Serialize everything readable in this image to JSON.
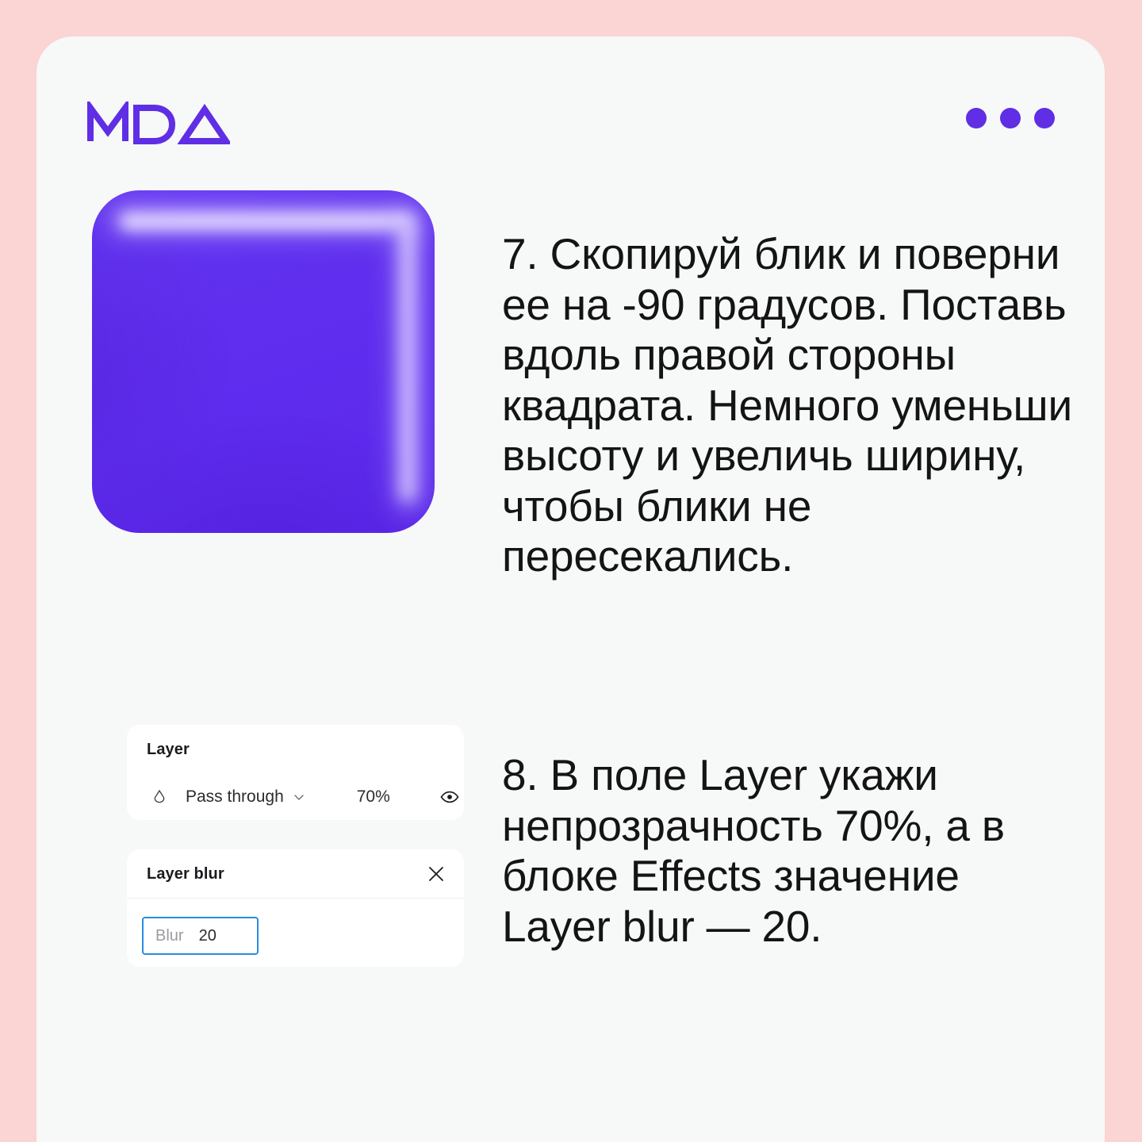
{
  "theme": {
    "page_background": "#FBD4D4",
    "card_background": "#F7F8F8",
    "brand_purple": "#5F2EE5",
    "square_fill": "#5F2EEE",
    "input_focus_blue": "#2B8CE0",
    "text_color": "#141414"
  },
  "header": {
    "logo_text": "MDA",
    "menu_icon": "kebab-menu-icon",
    "dots_count": 3
  },
  "artboard": {
    "shape_name": "rounded-square",
    "highlights": [
      "top-gloss",
      "right-gloss"
    ]
  },
  "figma_panels": {
    "layer": {
      "title": "Layer",
      "blend_icon": "blend-mode-droplet-icon",
      "blend_mode": "Pass through",
      "chevron_icon": "chevron-down-icon",
      "opacity": "70%",
      "visibility_icon": "eye-icon"
    },
    "layer_blur": {
      "title": "Layer blur",
      "close_icon": "close-icon",
      "field_label": "Blur",
      "field_value": "20"
    }
  },
  "steps": [
    {
      "id": "step-7",
      "text": "7. Скопируй блик и поверни ее на -90 градусов. Поставь вдоль правой стороны квадрата. Немного уменьши высоту и увеличь ширину, чтобы блики не пересекались."
    },
    {
      "id": "step-8",
      "text": "8. В поле Layer укажи непрозрачность 70%, а в блоке Effects значение Layer blur — 20."
    }
  ]
}
